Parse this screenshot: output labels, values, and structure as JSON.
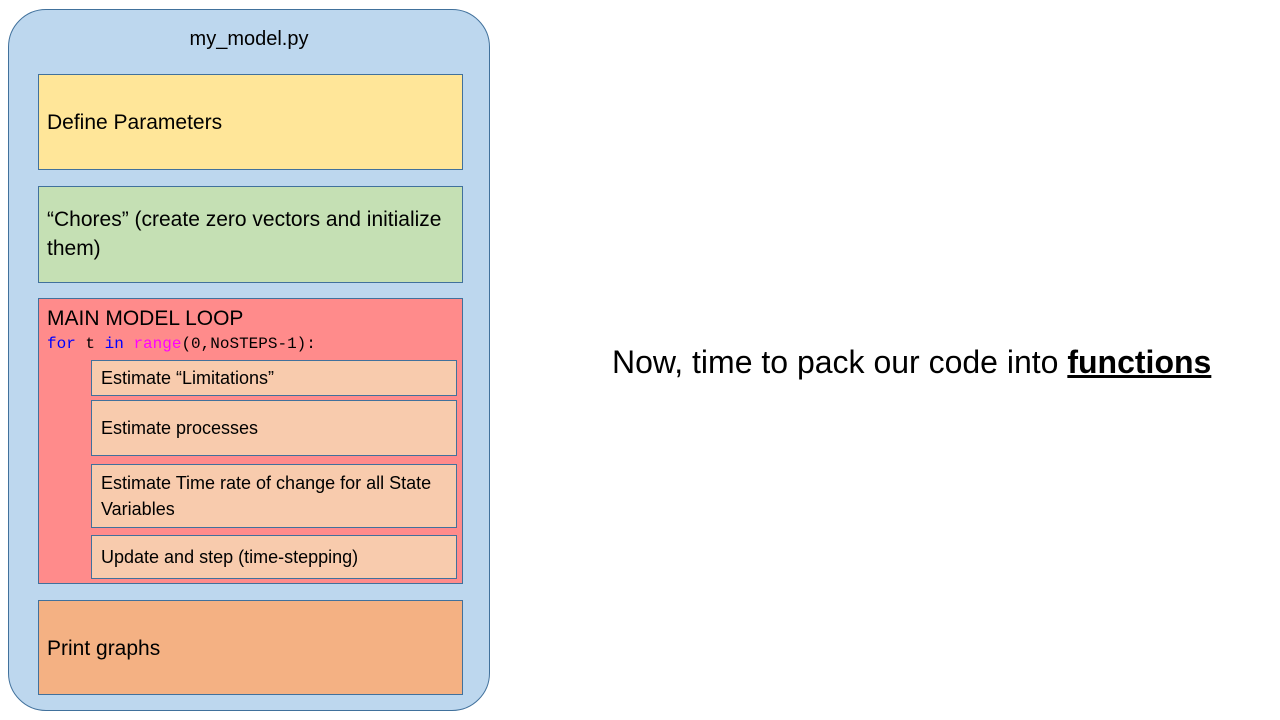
{
  "file": {
    "title": "my_model.py"
  },
  "blocks": {
    "define": "Define Parameters",
    "chores": "“Chores” (create zero vectors and initialize them)",
    "main_loop": {
      "title": "MAIN MODEL LOOP",
      "code": {
        "kw_for": "for",
        "var": " t ",
        "kw_in": "in",
        "space": " ",
        "builtin": "range",
        "args": "(0,NoSTEPS-1):"
      },
      "steps": [
        "Estimate “Limitations”",
        "Estimate processes",
        "Estimate Time rate of change for all State Variables",
        "Update and step (time-stepping)"
      ]
    },
    "graphs": "Print graphs"
  },
  "headline": {
    "text": "Now, time to pack our code into ",
    "emphasis": "functions"
  },
  "colors": {
    "container": "#bdd7ee",
    "define": "#ffe699",
    "chores": "#c5e0b4",
    "main_loop": "#ff8b8b",
    "steps": "#f8cbad",
    "graphs": "#f4b183",
    "border": "#41719c",
    "code_keyword": "#0000ff",
    "code_builtin": "#ff00ff"
  }
}
